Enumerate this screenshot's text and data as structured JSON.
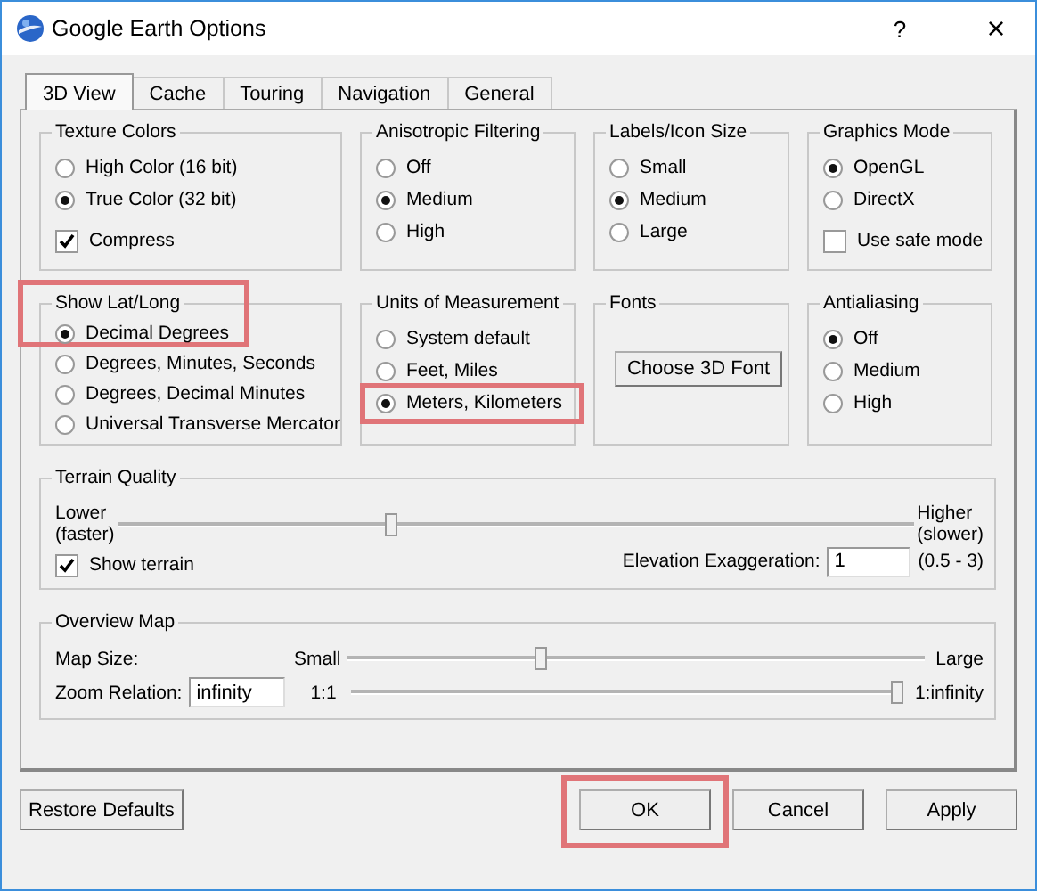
{
  "window": {
    "title": "Google Earth Options",
    "help": "?",
    "close": "×"
  },
  "tabs": [
    {
      "label": "3D View",
      "selected": true
    },
    {
      "label": "Cache",
      "selected": false
    },
    {
      "label": "Touring",
      "selected": false
    },
    {
      "label": "Navigation",
      "selected": false
    },
    {
      "label": "General",
      "selected": false
    }
  ],
  "groups": [
    {
      "title": "Texture Colors",
      "highlighted": false,
      "options": [
        {
          "kind": "radio",
          "label": "High Color (16 bit)",
          "selected": false,
          "highlighted": false
        },
        {
          "kind": "radio",
          "label": "True Color (32 bit)",
          "selected": true,
          "highlighted": false
        },
        {
          "kind": "checkbox",
          "label": "Compress",
          "checked": true,
          "highlighted": false
        }
      ]
    },
    {
      "title": "Anisotropic Filtering",
      "highlighted": false,
      "options": [
        {
          "kind": "radio",
          "label": "Off",
          "selected": false,
          "highlighted": false
        },
        {
          "kind": "radio",
          "label": "Medium",
          "selected": true,
          "highlighted": false
        },
        {
          "kind": "radio",
          "label": "High",
          "selected": false,
          "highlighted": false
        }
      ]
    },
    {
      "title": "Labels/Icon Size",
      "highlighted": false,
      "options": [
        {
          "kind": "radio",
          "label": "Small",
          "selected": false,
          "highlighted": false
        },
        {
          "kind": "radio",
          "label": "Medium",
          "selected": true,
          "highlighted": false
        },
        {
          "kind": "radio",
          "label": "Large",
          "selected": false,
          "highlighted": false
        }
      ]
    },
    {
      "title": "Graphics Mode",
      "highlighted": false,
      "options": [
        {
          "kind": "radio",
          "label": "OpenGL",
          "selected": true,
          "highlighted": false
        },
        {
          "kind": "radio",
          "label": "DirectX",
          "selected": false,
          "highlighted": false
        },
        {
          "kind": "checkbox",
          "label": "Use safe mode",
          "checked": false,
          "highlighted": false
        }
      ]
    },
    {
      "title": "Show Lat/Long",
      "highlighted": true,
      "options": [
        {
          "kind": "radio",
          "label": "Decimal Degrees",
          "selected": true,
          "highlighted": false
        },
        {
          "kind": "radio",
          "label": "Degrees, Minutes, Seconds",
          "selected": false,
          "highlighted": false
        },
        {
          "kind": "radio",
          "label": "Degrees, Decimal Minutes",
          "selected": false,
          "highlighted": false
        },
        {
          "kind": "radio",
          "label": "Universal Transverse Mercator",
          "selected": false,
          "highlighted": false
        }
      ]
    },
    {
      "title": "Units of Measurement",
      "highlighted": false,
      "options": [
        {
          "kind": "radio",
          "label": "System default",
          "selected": false,
          "highlighted": false
        },
        {
          "kind": "radio",
          "label": "Feet, Miles",
          "selected": false,
          "highlighted": false
        },
        {
          "kind": "radio",
          "label": "Meters, Kilometers",
          "selected": true,
          "highlighted": true
        }
      ]
    },
    {
      "title": "Fonts",
      "highlighted": false,
      "options": [
        {
          "kind": "button",
          "label": "Choose 3D Font",
          "highlighted": false
        }
      ]
    },
    {
      "title": "Antialiasing",
      "highlighted": false,
      "options": [
        {
          "kind": "radio",
          "label": "Off",
          "selected": true,
          "highlighted": false
        },
        {
          "kind": "radio",
          "label": "Medium",
          "selected": false,
          "highlighted": false
        },
        {
          "kind": "radio",
          "label": "High",
          "selected": false,
          "highlighted": false
        }
      ]
    }
  ],
  "terrain": {
    "title": "Terrain Quality",
    "lower": "Lower",
    "lower_note": "(faster)",
    "higher": "Higher",
    "higher_note": "(slower)",
    "level": 0.34,
    "show_terrain": {
      "label": "Show terrain",
      "checked": true
    },
    "exaggeration_label": "Elevation Exaggeration:",
    "exaggeration_value": "1",
    "exaggeration_range": "(0.5 - 3)"
  },
  "overview": {
    "title": "Overview Map",
    "map_size": {
      "label": "Map Size:",
      "min": "Small",
      "level": 0.33,
      "max": "Large"
    },
    "zoom_relation": {
      "label": "Zoom Relation:",
      "value": "infinity",
      "min": "1:1",
      "level": 1.0,
      "max": "1:infinity"
    }
  },
  "restore_button": "Restore Defaults",
  "buttons": [
    {
      "label": "OK",
      "highlighted": true
    },
    {
      "label": "Cancel",
      "highlighted": false
    },
    {
      "label": "Apply",
      "highlighted": false
    }
  ]
}
